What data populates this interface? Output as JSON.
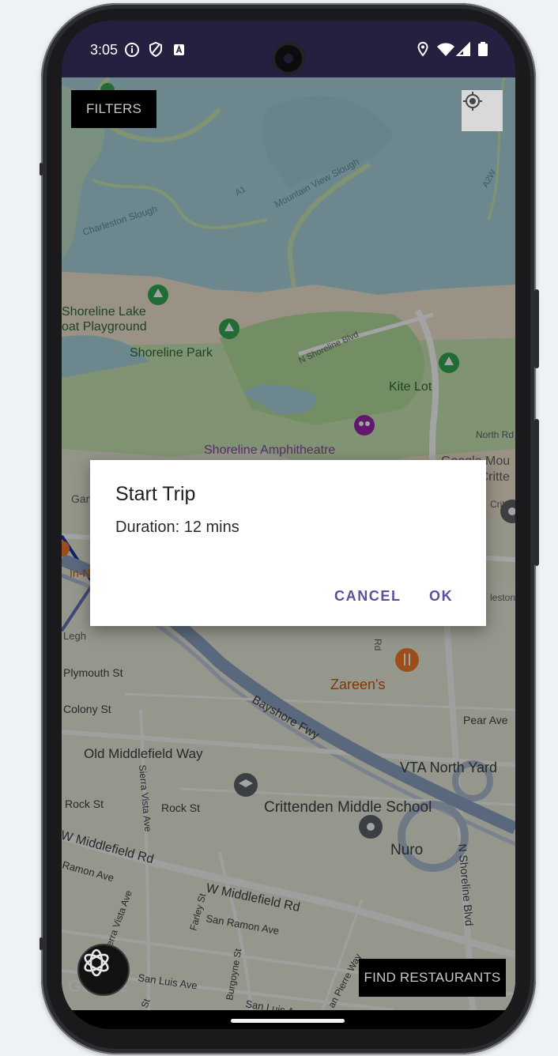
{
  "status_bar": {
    "time": "3:05",
    "left_icons": [
      "info-icon",
      "shield-icon",
      "a-icon"
    ],
    "right_icons": [
      "location-icon",
      "wifi-icon",
      "signal-icon",
      "battery-icon"
    ]
  },
  "map": {
    "filters_label": "FILTERS",
    "find_label": "FIND RESTAURANTS",
    "google_label": "Google",
    "labels": {
      "charleston_slough": "Charleston Slough",
      "a1": "A1",
      "mountain_view_slough": "Mountain View Slough",
      "a2w": "A2W",
      "shoreline_lake_1": "Shoreline Lake",
      "shoreline_lake_2": "oat Playground",
      "shoreline_park": "Shoreline Park",
      "n_shoreline_blvd": "N Shoreline Blvd",
      "kite_lot": "Kite Lot",
      "north_rd": "North Rd",
      "shoreline_amphitheatre": "Shoreline Amphitheatre",
      "google_mou_1": "Google Mou",
      "google_mou_2": "View - Critte",
      "gar": "Gar",
      "critt": "Critte",
      "in_n": "In-N",
      "leston": "leston",
      "legh": "Legh",
      "rd": "Rd",
      "plymouth_st": "Plymouth St",
      "zareens": "Zareen's",
      "colony_st": "Colony St",
      "pear_ave": "Pear Ave",
      "bayshore_fwy": "Bayshore Fwy",
      "old_middlefield": "Old Middlefield Way",
      "vta_north_yard": "VTA North Yard",
      "sierra_vista_ave_1": "Sierra Vista Ave",
      "rock_st_1": "Rock St",
      "rock_st_2": "Rock St",
      "crittenden": "Crittenden Middle School",
      "w_middlefield_1": "W Middlefield Rd",
      "nuro": "Nuro",
      "n_shoreline_blvd_2": "N Shoreline Blvd",
      "ramon_ave": "Ramon Ave",
      "w_middlefield_2": "W Middlefield Rd",
      "sierra_vista_ave_2": "Sierra Vista Ave",
      "farley_st": "Farley St",
      "san_ramon_ave": "San Ramon Ave",
      "burgoyne_st": "Burgoyne St",
      "san_luis_ave_1": "San Luis Ave",
      "san_luis_ave_2": "San Luis Ave",
      "san_pierre_way": "an Pierre Way",
      "st": "St"
    }
  },
  "dialog": {
    "title": "Start Trip",
    "message": "Duration: 12 mins",
    "cancel_label": "CANCEL",
    "ok_label": "OK"
  },
  "colors": {
    "status_bar": "#25203f",
    "water": "#aad3df",
    "land": "#e8ead6",
    "park": "#c9e6b2",
    "accent": "#5d4f9c"
  }
}
